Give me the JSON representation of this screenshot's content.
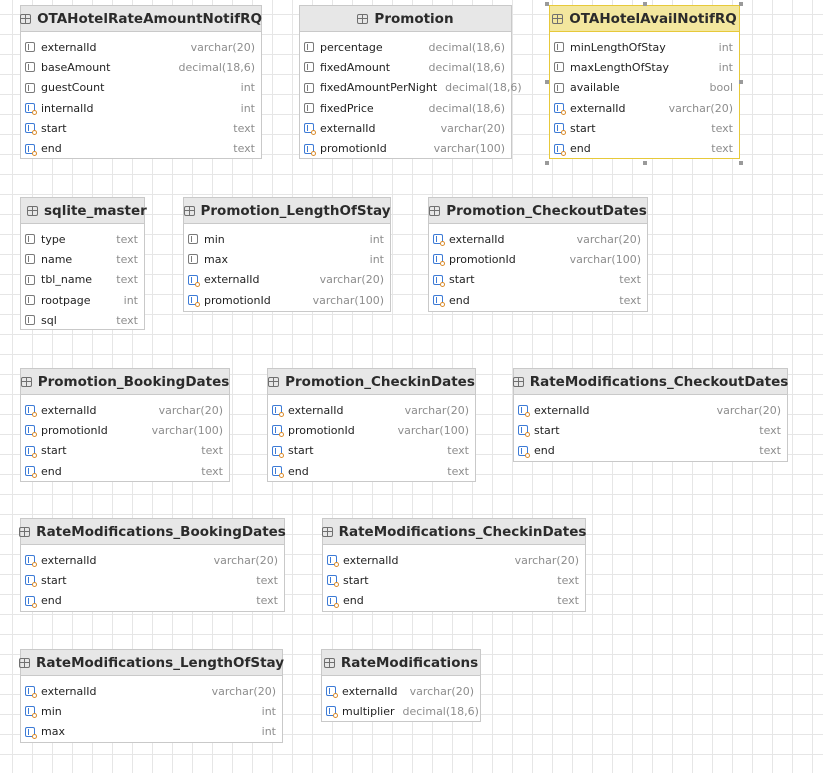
{
  "tables": [
    {
      "name": "OTAHotelRateAmountNotifRQ",
      "columns": [
        {
          "name": "externalId",
          "type": "varchar(20)",
          "indexed": false
        },
        {
          "name": "baseAmount",
          "type": "decimal(18,6)",
          "indexed": false
        },
        {
          "name": "guestCount",
          "type": "int",
          "indexed": false
        },
        {
          "name": "internalId",
          "type": "int",
          "indexed": true
        },
        {
          "name": "start",
          "type": "text",
          "indexed": true
        },
        {
          "name": "end",
          "type": "text",
          "indexed": true
        }
      ]
    },
    {
      "name": "Promotion",
      "columns": [
        {
          "name": "percentage",
          "type": "decimal(18,6)",
          "indexed": false
        },
        {
          "name": "fixedAmount",
          "type": "decimal(18,6)",
          "indexed": false
        },
        {
          "name": "fixedAmountPerNight",
          "type": "decimal(18,6)",
          "indexed": false
        },
        {
          "name": "fixedPrice",
          "type": "decimal(18,6)",
          "indexed": false
        },
        {
          "name": "externalId",
          "type": "varchar(20)",
          "indexed": true
        },
        {
          "name": "promotionId",
          "type": "varchar(100)",
          "indexed": true
        }
      ]
    },
    {
      "name": "OTAHotelAvailNotifRQ",
      "selected": true,
      "columns": [
        {
          "name": "minLengthOfStay",
          "type": "int",
          "indexed": false
        },
        {
          "name": "maxLengthOfStay",
          "type": "int",
          "indexed": false
        },
        {
          "name": "available",
          "type": "bool",
          "indexed": false
        },
        {
          "name": "externalId",
          "type": "varchar(20)",
          "indexed": true
        },
        {
          "name": "start",
          "type": "text",
          "indexed": true
        },
        {
          "name": "end",
          "type": "text",
          "indexed": true
        }
      ]
    },
    {
      "name": "sqlite_master",
      "columns": [
        {
          "name": "type",
          "type": "text",
          "indexed": false
        },
        {
          "name": "name",
          "type": "text",
          "indexed": false
        },
        {
          "name": "tbl_name",
          "type": "text",
          "indexed": false
        },
        {
          "name": "rootpage",
          "type": "int",
          "indexed": false
        },
        {
          "name": "sql",
          "type": "text",
          "indexed": false
        }
      ]
    },
    {
      "name": "Promotion_LengthOfStay",
      "columns": [
        {
          "name": "min",
          "type": "int",
          "indexed": false
        },
        {
          "name": "max",
          "type": "int",
          "indexed": false
        },
        {
          "name": "externalId",
          "type": "varchar(20)",
          "indexed": true
        },
        {
          "name": "promotionId",
          "type": "varchar(100)",
          "indexed": true
        }
      ]
    },
    {
      "name": "Promotion_CheckoutDates",
      "columns": [
        {
          "name": "externalId",
          "type": "varchar(20)",
          "indexed": true
        },
        {
          "name": "promotionId",
          "type": "varchar(100)",
          "indexed": true
        },
        {
          "name": "start",
          "type": "text",
          "indexed": true
        },
        {
          "name": "end",
          "type": "text",
          "indexed": true
        }
      ]
    },
    {
      "name": "Promotion_BookingDates",
      "columns": [
        {
          "name": "externalId",
          "type": "varchar(20)",
          "indexed": true
        },
        {
          "name": "promotionId",
          "type": "varchar(100)",
          "indexed": true
        },
        {
          "name": "start",
          "type": "text",
          "indexed": true
        },
        {
          "name": "end",
          "type": "text",
          "indexed": true
        }
      ]
    },
    {
      "name": "Promotion_CheckinDates",
      "columns": [
        {
          "name": "externalId",
          "type": "varchar(20)",
          "indexed": true
        },
        {
          "name": "promotionId",
          "type": "varchar(100)",
          "indexed": true
        },
        {
          "name": "start",
          "type": "text",
          "indexed": true
        },
        {
          "name": "end",
          "type": "text",
          "indexed": true
        }
      ]
    },
    {
      "name": "RateModifications_CheckoutDates",
      "columns": [
        {
          "name": "externalId",
          "type": "varchar(20)",
          "indexed": true
        },
        {
          "name": "start",
          "type": "text",
          "indexed": true
        },
        {
          "name": "end",
          "type": "text",
          "indexed": true
        }
      ]
    },
    {
      "name": "RateModifications_BookingDates",
      "columns": [
        {
          "name": "externalId",
          "type": "varchar(20)",
          "indexed": true
        },
        {
          "name": "start",
          "type": "text",
          "indexed": true
        },
        {
          "name": "end",
          "type": "text",
          "indexed": true
        }
      ]
    },
    {
      "name": "RateModifications_CheckinDates",
      "columns": [
        {
          "name": "externalId",
          "type": "varchar(20)",
          "indexed": true
        },
        {
          "name": "start",
          "type": "text",
          "indexed": true
        },
        {
          "name": "end",
          "type": "text",
          "indexed": true
        }
      ]
    },
    {
      "name": "RateModifications_LengthOfStay",
      "columns": [
        {
          "name": "externalId",
          "type": "varchar(20)",
          "indexed": true
        },
        {
          "name": "min",
          "type": "int",
          "indexed": true
        },
        {
          "name": "max",
          "type": "int",
          "indexed": true
        }
      ]
    },
    {
      "name": "RateModifications",
      "columns": [
        {
          "name": "externalId",
          "type": "varchar(20)",
          "indexed": true
        },
        {
          "name": "multiplier",
          "type": "decimal(18,6)",
          "indexed": true
        }
      ]
    }
  ]
}
